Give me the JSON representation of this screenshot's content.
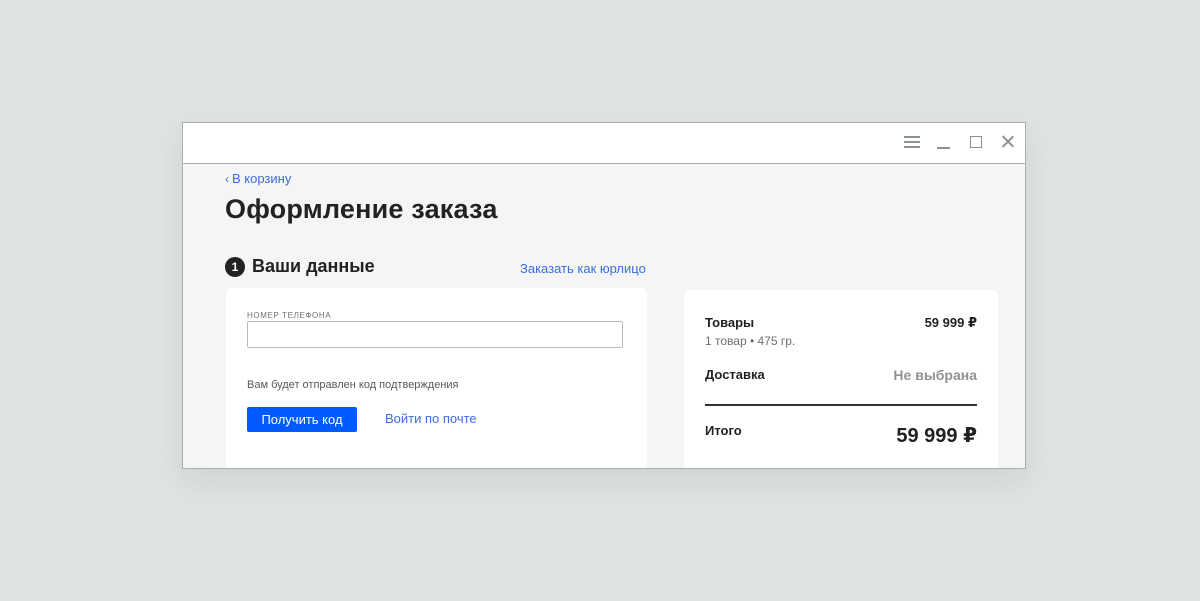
{
  "window": {
    "controls": [
      "menu-icon",
      "minimize-icon",
      "maximize-icon",
      "close-icon"
    ]
  },
  "nav": {
    "back_icon": "chevron-left-icon",
    "back_label": "В корзину"
  },
  "page": {
    "title": "Оформление заказа"
  },
  "step": {
    "number": "1",
    "title": "Ваши данные",
    "legal_link": "Заказать как юрлицо"
  },
  "form": {
    "phone_label": "НОМЕР ТЕЛЕФОНА",
    "phone_value": "",
    "hint": "Вам будет отправлен код подтверждения",
    "get_code_label": "Получить код",
    "email_login_label": "Войти по почте"
  },
  "summary": {
    "goods_label": "Товары",
    "goods_value": "59 999 ₽",
    "goods_sub": "1 товар • 475 гр.",
    "delivery_label": "Доставка",
    "delivery_value": "Не выбрана",
    "total_label": "Итого",
    "total_value": "59 999 ₽"
  },
  "colors": {
    "accent": "#005bff",
    "link": "#3a6fd8",
    "background": "#dfe3e2"
  }
}
